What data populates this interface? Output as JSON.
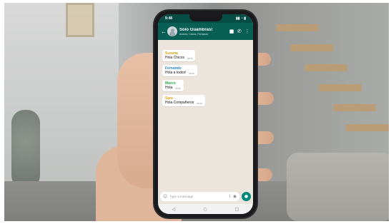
{
  "status_bar": {
    "time": "9:48",
    "indicators": "▮▮ ◔ ▮"
  },
  "chat_header": {
    "back_icon": "←",
    "title": "Solo Guambras!",
    "participants": "Andrea, Carlos, Fernando",
    "video_icon": "■",
    "call_icon": "✆",
    "menu_icon": "⋮"
  },
  "messages": [
    {
      "sender": "Susana",
      "sender_color": "#d4a017",
      "text": "Hola Chicos",
      "time": "08:25"
    },
    {
      "sender": "Fernando",
      "sender_color": "#1e88c8",
      "text": "Hola a todos!",
      "time": "08:25"
    },
    {
      "sender": "Marco",
      "sender_color": "#2eaa4a",
      "text": "Hola",
      "time": "08:25"
    },
    {
      "sender": "Sara",
      "sender_color": "#e6a020",
      "text": "Hola Compañeros",
      "time": "08:26"
    }
  ],
  "input": {
    "placeholder": "Type a message",
    "emoji_icon": "☺",
    "attach_icon": "⌇",
    "camera_icon": "◉",
    "mic_icon": "●"
  },
  "nav": {
    "back": "◁",
    "home": "○",
    "recents": "□"
  }
}
